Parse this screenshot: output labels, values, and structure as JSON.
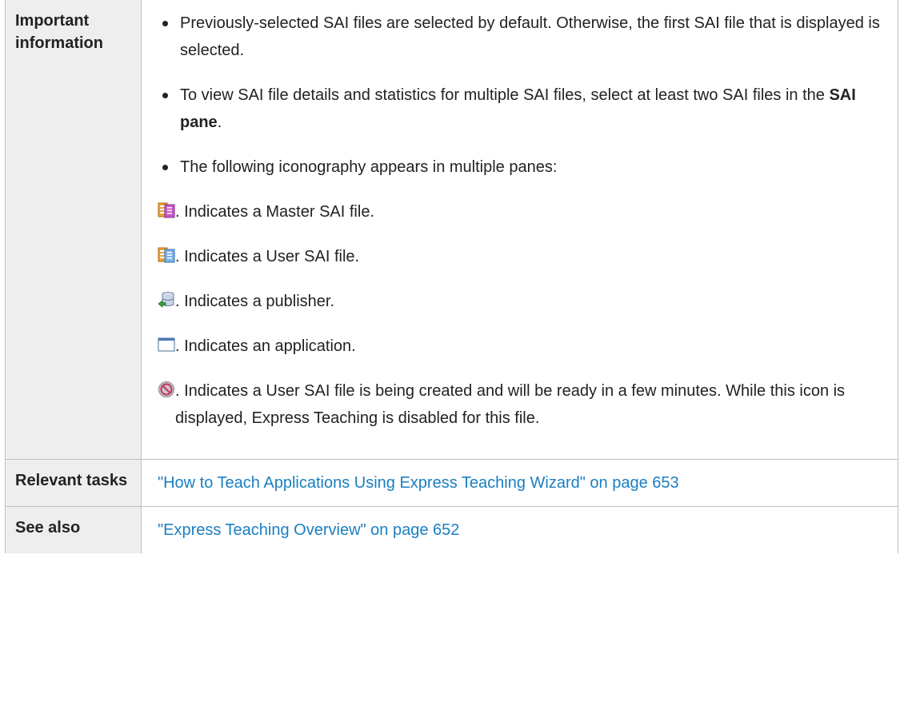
{
  "rows": {
    "important": {
      "label": "Important information",
      "bullets": [
        "Previously-selected SAI files are selected by default. Otherwise, the first SAI file that is displayed is selected.",
        {
          "before": "To view SAI file details and statistics for multiple SAI files, select at least two SAI files in the ",
          "bold": "SAI pane",
          "after": "."
        },
        "The following iconography appears in multiple panes:"
      ],
      "icons": [
        {
          "icon": "master-sai-file-icon",
          "text": ". Indicates a Master SAI file."
        },
        {
          "icon": "user-sai-file-icon",
          "text": ". Indicates a User SAI file."
        },
        {
          "icon": "publisher-icon",
          "text": ". Indicates a publisher."
        },
        {
          "icon": "application-window-icon",
          "text": ". Indicates an application."
        },
        {
          "icon": "creating-disabled-icon",
          "text": ". Indicates a User SAI file is being created and will be ready in a few minutes. While this icon is displayed, Express Teaching is disabled for this file."
        }
      ]
    },
    "relevant": {
      "label": "Relevant tasks",
      "link": "\"How to Teach Applications Using Express Teaching Wizard\" on page 653"
    },
    "see_also": {
      "label": "See also",
      "link": "\"Express Teaching Overview\" on page 652"
    }
  },
  "colors": {
    "link": "#1a7fc1",
    "label_bg": "#eeeeee",
    "border": "#c0c0c0"
  }
}
